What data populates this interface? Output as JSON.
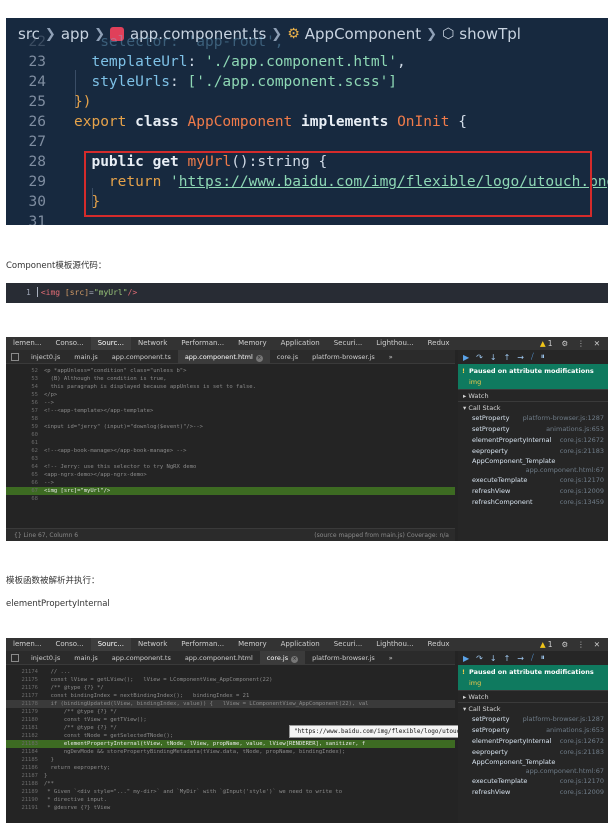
{
  "editor": {
    "breadcrumb": [
      "src",
      "app",
      "app.component.ts",
      "AppComponent",
      "showTpl"
    ],
    "lines": [
      {
        "n": "22",
        "text": "selector: 'app-root',"
      },
      {
        "n": "23",
        "key": "templateUrl",
        "val": "'./app.component.html'",
        "tail": ","
      },
      {
        "n": "24",
        "key": "styleUrls",
        "val": "['./app.component.scss']"
      },
      {
        "n": "25",
        "text": "})"
      },
      {
        "n": "26"
      },
      {
        "n": "27",
        "text": ""
      },
      {
        "n": "28"
      },
      {
        "n": "29",
        "kw": "return",
        "url": "https://www.baidu.com/img/flexible/logo/utouch.png"
      },
      {
        "n": "30",
        "text": "}"
      },
      {
        "n": "31",
        "text": ""
      }
    ],
    "l26": {
      "export": "export",
      "class": "class",
      "name": "AppComponent",
      "impl": "implements",
      "iface": "OnInit",
      "brace": "{"
    },
    "l28": {
      "public": "public",
      "get": "get",
      "name": "myUrl",
      "sig": "():string {"
    }
  },
  "para1": "Component模板源代码：",
  "template_code": {
    "line_no": "1",
    "tag_open": "<img",
    "attr": "[src]",
    "eq": "=",
    "val": "\"myUrl\"",
    "tag_close": "/>"
  },
  "para2": "模板函数被解析并执行：",
  "para3": "elementPropertyInternal",
  "devtools": {
    "tabs": [
      "lemen...",
      "Conso...",
      "Sourc...",
      "Network",
      "Performan...",
      "Memory",
      "Application",
      "Securi...",
      "Lighthou...",
      "Redux"
    ],
    "active_tab": "Sourc...",
    "warn_count": "1",
    "files": [
      "inject0.js",
      "main.js",
      "app.component.ts",
      "app.component.html",
      "core.js",
      "platform-browser.js"
    ],
    "active_file_1": "app.component.html",
    "more": "»",
    "paused_title": "Paused on attribute modifications",
    "paused_sub": "img",
    "watch": "Watch",
    "call_stack": "Call Stack",
    "stack_1": [
      {
        "fn": "setProperty",
        "loc": "platform-browser.js:1287"
      },
      {
        "fn": "setProperty",
        "loc": "animations.js:653"
      },
      {
        "fn": "elementPropertyInternal",
        "loc": "core.js:12672"
      },
      {
        "fn": "eeproperty",
        "loc": "core.js:21183"
      },
      {
        "fn": "AppComponent_Template",
        "loc": "app.component.html:67"
      },
      {
        "fn": "executeTemplate",
        "loc": "core.js:12170"
      },
      {
        "fn": "refreshView",
        "loc": "core.js:12009"
      },
      {
        "fn": "refreshComponent",
        "loc": "core.js:13459"
      }
    ],
    "code_1": [
      {
        "n": "52",
        "t": "<p *appUnless=\"condition\" class=\"unless b\">"
      },
      {
        "n": "53",
        "t": "  (B) Although the condition is true,"
      },
      {
        "n": "54",
        "t": "  this paragraph is displayed because appUnless is set to false."
      },
      {
        "n": "55",
        "t": "</p>"
      },
      {
        "n": "56",
        "t": "-->"
      },
      {
        "n": "57",
        "t": "<!--<app-template></app-template>"
      },
      {
        "n": "58",
        "t": ""
      },
      {
        "n": "59",
        "t": "<input id=\"jerry\" (input)=\"downlog($event)\"/>-->"
      },
      {
        "n": "60",
        "t": ""
      },
      {
        "n": "61",
        "t": ""
      },
      {
        "n": "62",
        "t": "<!--<app-book-manage></app-book-manage> -->"
      },
      {
        "n": "63",
        "t": ""
      },
      {
        "n": "64",
        "t": "<!-- Jerry: use this selector to try NgRX demo"
      },
      {
        "n": "65",
        "t": "<app-ngrx-demo></app-ngrx-demo>"
      },
      {
        "n": "66",
        "t": "-->"
      },
      {
        "n": "67",
        "t": "<img [src]=\"myUrl\"/>"
      },
      {
        "n": "68",
        "t": ""
      }
    ],
    "status_left": "{}  Line 67, Column 6",
    "status_right": "(source mapped from main.js)  Coverage: n/a",
    "active_file_2": "core.js",
    "code_2": [
      {
        "n": "21174",
        "t": "  // ..."
      },
      {
        "n": "21175",
        "t": "  const lView = getLView();   lView = LComponentView_AppComponent(22)"
      },
      {
        "n": "21176",
        "t": "  /** @type {?} */"
      },
      {
        "n": "21177",
        "t": "  const bindingIndex = nextBindingIndex();   bindingIndex = 21"
      },
      {
        "n": "21178",
        "t": "  if (bindingUpdated(lView, bindingIndex, value)) {   lView = LComponentView_AppComponent(22), val"
      },
      {
        "n": "21179",
        "t": "      /** @type {?} */"
      },
      {
        "n": "21180",
        "t": "      const tView = getTView();"
      },
      {
        "n": "21181",
        "t": "      /** @type {?} */"
      },
      {
        "n": "21182",
        "t": "      const tNode = getSelectedTNode();"
      },
      {
        "n": "21183",
        "t": "      elementPropertyInternal(tView, tNode, lView, propName, value, lView[RENDERER], sanitizer, f"
      },
      {
        "n": "21184",
        "t": "      ngDevMode && storePropertyBindingMetadata(tView.data, tNode, propName, bindingIndex);"
      },
      {
        "n": "21185",
        "t": "  }"
      },
      {
        "n": "21186",
        "t": "  return eeproperty;"
      },
      {
        "n": "21187",
        "t": "}"
      },
      {
        "n": "21188",
        "t": "/**"
      },
      {
        "n": "21189",
        "t": " * Given `<div style=\"...\" my-dir>` and `MyDir` with `@Input('style')` we need to write to"
      },
      {
        "n": "21190",
        "t": " * directive input."
      },
      {
        "n": "21191",
        "t": " * @desrve {?} tView"
      }
    ],
    "tooltip": "\"https://www.baidu.com/img/flexible/logo/utouch.png\"",
    "stack_2": [
      {
        "fn": "setProperty",
        "loc": "platform-browser.js:1287"
      },
      {
        "fn": "setProperty",
        "loc": "animations.js:653"
      },
      {
        "fn": "elementPropertyInternal",
        "loc": "core.js:12672"
      },
      {
        "fn": "eeproperty",
        "loc": "core.js:21183"
      },
      {
        "fn": "AppComponent_Template",
        "loc": "app.component.html:67"
      },
      {
        "fn": "executeTemplate",
        "loc": "core.js:12170"
      },
      {
        "fn": "refreshView",
        "loc": "core.js:12009"
      }
    ]
  }
}
